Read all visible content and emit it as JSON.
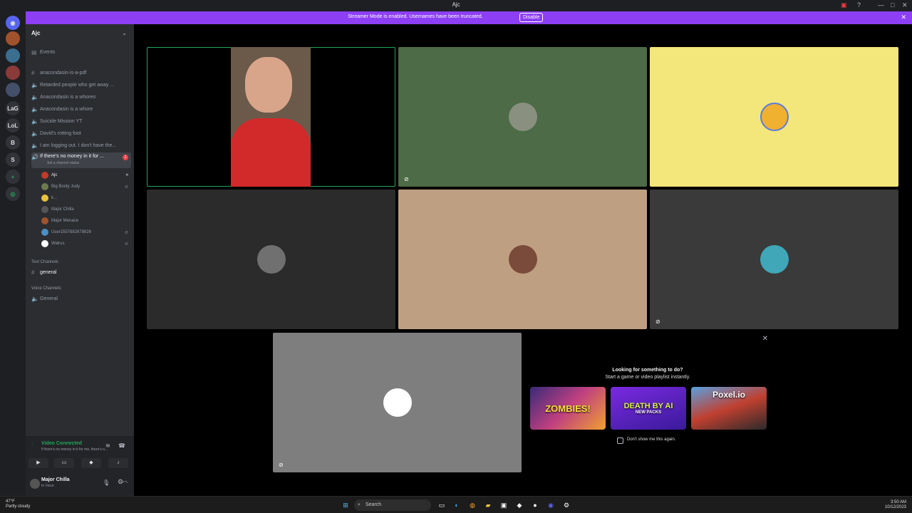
{
  "window": {
    "title": "Ajc"
  },
  "banner": {
    "message": "Streamer Mode is enabled. Usernames have been truncated.",
    "button": "Disable"
  },
  "guilds": [
    "LaG",
    "LoL",
    "B",
    "S"
  ],
  "server": {
    "name": "Ajc",
    "events_label": "Events",
    "channels": [
      {
        "type": "text",
        "name": "anacondasin-is-a-pdf"
      },
      {
        "type": "voice",
        "name": "Retarded people who get away ..."
      },
      {
        "type": "voice",
        "name": "Anacondasin is a whoreo"
      },
      {
        "type": "voice",
        "name": "Anacondasin is a whore"
      },
      {
        "type": "voice",
        "name": "Suicide Mission YT"
      },
      {
        "type": "voice",
        "name": "David's rotting foot"
      },
      {
        "type": "voice",
        "name": "I am logging out. I don't have the..."
      }
    ],
    "active_channel": {
      "name": "If there's no money in it for ...",
      "status": "Set a channel status",
      "badge": "1"
    },
    "voice_users": [
      {
        "name": "Ajc",
        "color": "#c0392b"
      },
      {
        "name": "Big Booty Judy",
        "color": "#6d7a4f"
      },
      {
        "name": "k...",
        "color": "#e8c33b"
      },
      {
        "name": "Major Chilla",
        "color": "#555"
      },
      {
        "name": "Major Menace",
        "color": "#a0522d"
      },
      {
        "name": "User1557882678826",
        "color": "#4a90c2"
      },
      {
        "name": "Walrus",
        "color": "#ffffff"
      }
    ],
    "text_category": "Text Channels",
    "text_channel": "general",
    "voice_category": "Voice Channels",
    "voice_channel": "General"
  },
  "voice_panel": {
    "status": "Video Connected",
    "channel": "If there's no money in it for me, there's n..."
  },
  "user_panel": {
    "name": "Major Chilla",
    "status": "In Voice"
  },
  "tiles": [
    {
      "kind": "video",
      "bg": "#000000",
      "speaking": true,
      "muted": false
    },
    {
      "kind": "avatar",
      "bg": "#4d6b46",
      "avatar": "wolf-avatar",
      "muted": true
    },
    {
      "kind": "avatar",
      "bg": "#f3e67a",
      "avatar": "pikachu-avatar",
      "muted": false
    },
    {
      "kind": "avatar",
      "bg": "#2b2b2b",
      "avatar": "cat-avatar",
      "muted": false
    },
    {
      "kind": "avatar",
      "bg": "#bf9f82",
      "avatar": "person-avatar",
      "muted": false
    },
    {
      "kind": "avatar",
      "bg": "#3a3a3a",
      "avatar": "creature-avatar",
      "muted": true
    },
    {
      "kind": "avatar",
      "bg": "#7e7e7e",
      "avatar": "stickman-avatar",
      "muted": true
    }
  ],
  "activity_popup": {
    "heading": "Looking for something to do?",
    "subheading": "Start a game or video playlist instantly.",
    "cards": [
      "ZOMBIES!",
      "DEATH BY AI",
      "Poxel.io"
    ],
    "card_subs": [
      "",
      "NEW PACKS",
      ""
    ],
    "checkbox": "Don't show me this again."
  },
  "taskbar": {
    "search": "Search",
    "weather_temp": "47°F",
    "weather_desc": "Partly cloudy",
    "time": "3:50 AM",
    "date": "10/12/2023"
  }
}
